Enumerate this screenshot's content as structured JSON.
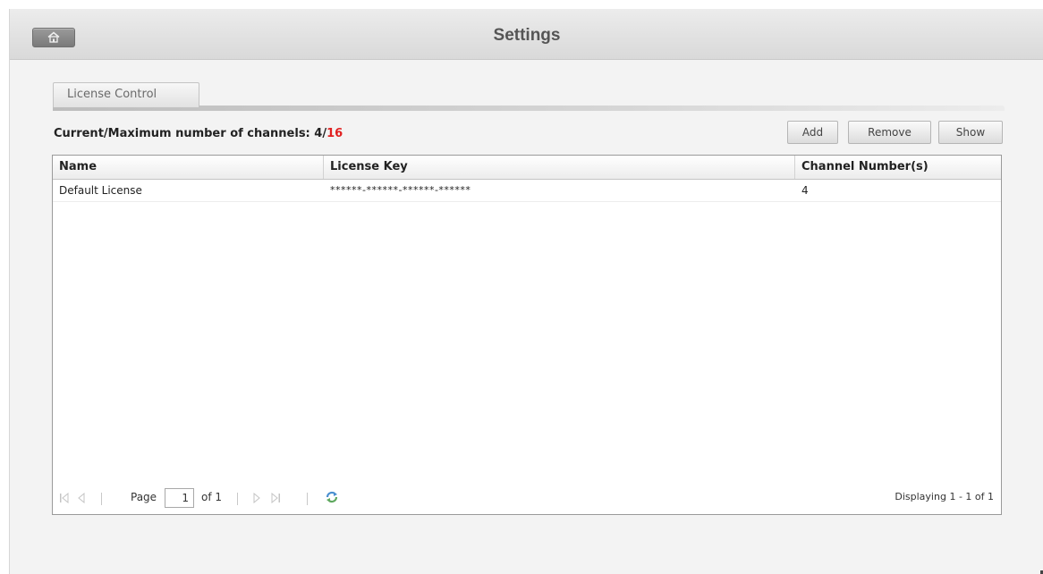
{
  "header": {
    "title": "Settings"
  },
  "tabs": [
    {
      "label": "License Control"
    }
  ],
  "channels": {
    "label": "Current/Maximum number of channels: ",
    "current": "4",
    "separator": "/",
    "maximum": "16"
  },
  "toolbar": {
    "add_label": "Add",
    "remove_label": "Remove",
    "show_label": "Show"
  },
  "table": {
    "columns": [
      "Name",
      "License Key",
      "Channel Number(s)"
    ],
    "rows": [
      {
        "name": "Default License",
        "license_key": "******-******-******-******",
        "channels": "4"
      }
    ]
  },
  "pager": {
    "page_label": "Page",
    "page_value": "1",
    "of_label": "of 1",
    "displaying": "Displaying 1 - 1 of 1"
  },
  "icons": [
    "home-icon",
    "first-page-icon",
    "prev-page-icon",
    "next-page-icon",
    "last-page-icon",
    "refresh-icon"
  ],
  "colors": {
    "max_channels": "#e02020",
    "titlebar": "#dcdcdc"
  }
}
